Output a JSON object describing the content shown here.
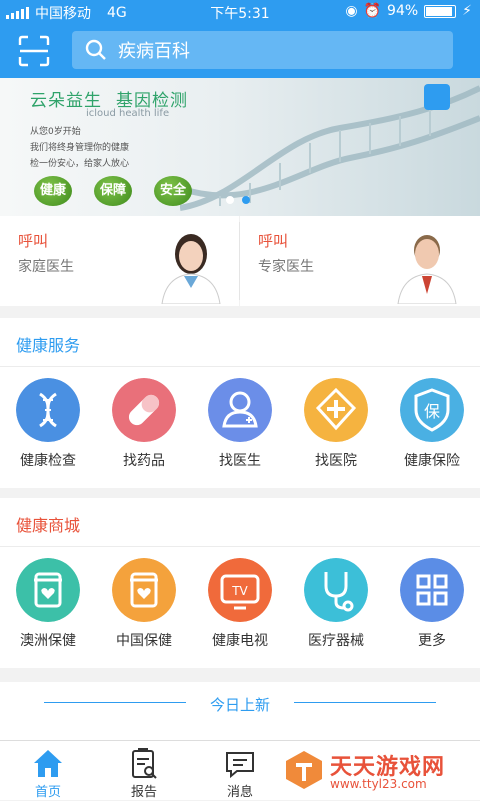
{
  "status": {
    "carrier": "中国移动",
    "network": "4G",
    "time": "下午5:31",
    "battery": "94%",
    "battery_level": 0.94
  },
  "search": {
    "placeholder": "疾病百科"
  },
  "banner": {
    "title_a": "云朵益生",
    "title_b": "基因检测",
    "title_en": "icloud health life",
    "line1": "从您0岁开始",
    "line2": "我们将终身管理你的健康",
    "line3": "检一份安心，给家人放心",
    "pills": [
      "健康",
      "保障",
      "安全"
    ]
  },
  "calls": [
    {
      "label": "呼叫",
      "sub": "家庭医生"
    },
    {
      "label": "呼叫",
      "sub": "专家医生"
    }
  ],
  "health_services": {
    "title": "健康服务",
    "items": [
      {
        "label": "健康检查",
        "icon": "dna-icon",
        "color": "#4a90e2"
      },
      {
        "label": "找药品",
        "icon": "pill-icon",
        "color": "#e9707a"
      },
      {
        "label": "找医生",
        "icon": "doctor-icon",
        "color": "#6b8ee8"
      },
      {
        "label": "找医院",
        "icon": "hospital-cross-icon",
        "color": "#f5b340"
      },
      {
        "label": "健康保险",
        "icon": "shield-icon",
        "color": "#4ab0e3"
      }
    ]
  },
  "health_mall": {
    "title": "健康商城",
    "items": [
      {
        "label": "澳洲保健",
        "icon": "supplement-jar-icon",
        "color": "#3cc0a8"
      },
      {
        "label": "中国保健",
        "icon": "supplement-jar-icon",
        "color": "#f4a23c"
      },
      {
        "label": "健康电视",
        "icon": "tv-icon",
        "color": "#f06a3b"
      },
      {
        "label": "医疗器械",
        "icon": "stethoscope-icon",
        "color": "#3cbfd8"
      },
      {
        "label": "更多",
        "icon": "grid-icon",
        "color": "#5b8de6"
      }
    ]
  },
  "today_new": "今日上新",
  "tabs": [
    {
      "label": "首页",
      "icon": "home-icon",
      "active": true
    },
    {
      "label": "报告",
      "icon": "report-icon",
      "active": false
    },
    {
      "label": "消息",
      "icon": "message-icon",
      "active": false
    }
  ],
  "watermark": {
    "name": "天天游戏网",
    "url": "www.ttyl23.com"
  },
  "colors": {
    "primary": "#2e9cf0",
    "accent_red": "#e8523a"
  }
}
